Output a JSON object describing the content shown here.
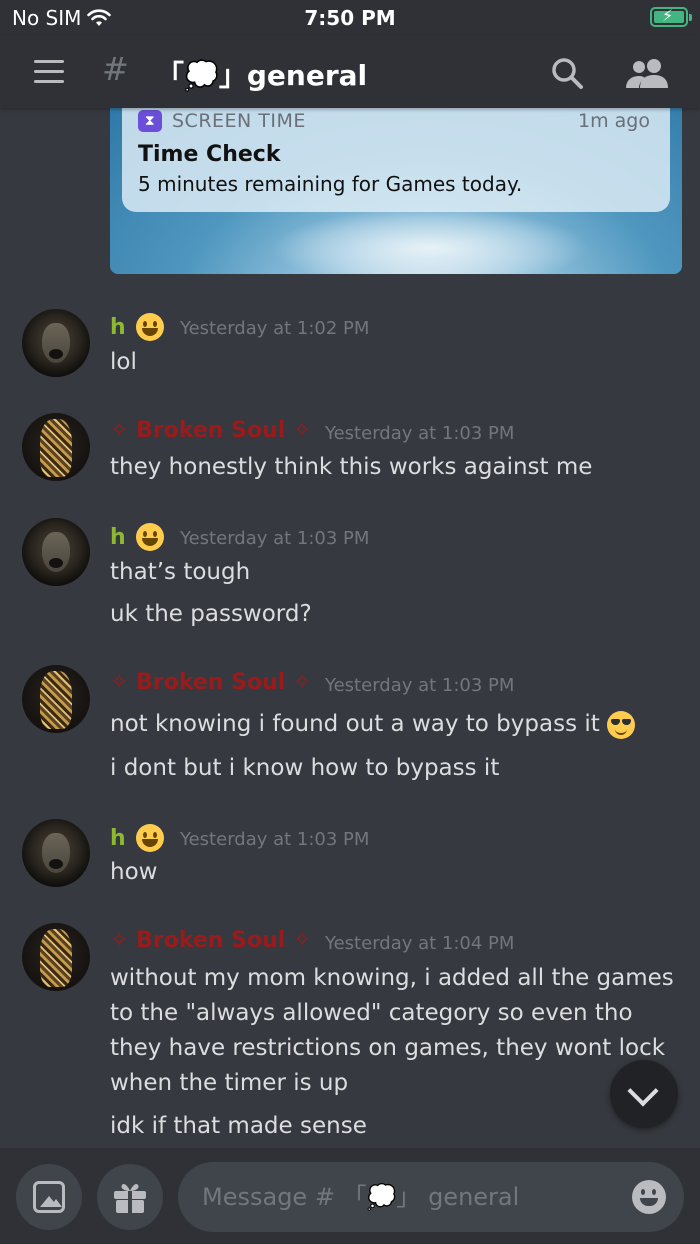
{
  "status_bar": {
    "carrier": "No SIM",
    "time": "7:50 PM"
  },
  "header": {
    "hash": "#",
    "channel_title": "「💭」general"
  },
  "embed": {
    "notification": {
      "app_name": "SCREEN TIME",
      "ago": "1m ago",
      "title": "Time Check",
      "body": "5 minutes remaining for Games today."
    }
  },
  "users": {
    "h": {
      "name": "h",
      "color": "#8fb832"
    },
    "broken": {
      "name": "✧ Broken Soul ✧",
      "color": "#991b1b"
    }
  },
  "messages": [
    {
      "author": "h",
      "timestamp": "Yesterday at 1:02 PM",
      "lines": [
        "lol"
      ]
    },
    {
      "author": "✧ Broken Soul ✧",
      "timestamp": "Yesterday at 1:03 PM",
      "lines": [
        "they honestly think this works against me"
      ]
    },
    {
      "author": "h",
      "timestamp": "Yesterday at 1:03 PM",
      "lines": [
        "that’s tough",
        "uk the password?"
      ]
    },
    {
      "author": "✧ Broken Soul ✧",
      "timestamp": "Yesterday at 1:03 PM",
      "lines": [
        "not knowing i found out a way to bypass it",
        "i dont but i know how to bypass it"
      ]
    },
    {
      "author": "h",
      "timestamp": "Yesterday at 1:03 PM",
      "lines": [
        "how"
      ]
    },
    {
      "author": "✧ Broken Soul ✧",
      "timestamp": "Yesterday at 1:04 PM",
      "lines": [
        "without my mom knowing, i added all the games to the \"always allowed\" category so even tho they have restrictions on games, they wont lock when the timer is up",
        "idk if that made sense"
      ]
    }
  ],
  "composer": {
    "placeholder": "Message # 「💭」 general"
  },
  "icons": {
    "menu": "hamburger-icon",
    "search": "search-icon",
    "members": "members-icon",
    "image": "image-icon",
    "gift": "gift-icon",
    "emoji": "emoji-icon",
    "scroll": "chevron-down-icon"
  }
}
